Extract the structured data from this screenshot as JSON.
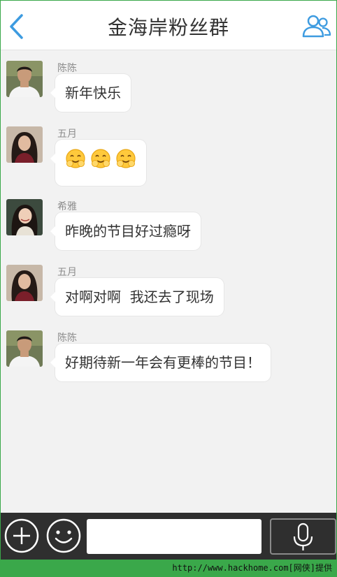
{
  "header": {
    "title": "金海岸粉丝群",
    "back_icon": "chevron-left-icon",
    "members_icon": "group-members-icon"
  },
  "messages": [
    {
      "sender": "陈陈",
      "avatar": "male-avatar",
      "text": "新年快乐"
    },
    {
      "sender": "五月",
      "avatar": "female-avatar-long-hair",
      "text": "",
      "emojis": [
        "hug-emoji",
        "hug-emoji",
        "hug-emoji"
      ]
    },
    {
      "sender": "希雅",
      "avatar": "female-avatar-smiling",
      "text": "昨晚的节目好过瘾呀"
    },
    {
      "sender": "五月",
      "avatar": "female-avatar-long-hair",
      "text": "对啊对啊  我还去了现场"
    },
    {
      "sender": "陈陈",
      "avatar": "male-avatar",
      "text": "好期待新一年会有更棒的节目！"
    }
  ],
  "toolbar": {
    "add_icon": "plus-circle-icon",
    "emoji_icon": "smiley-icon",
    "input_value": "",
    "voice_icon": "microphone-icon"
  },
  "watermark": "http://www.hackhome.com[网侠]提供",
  "colors": {
    "accent_blue": "#3d9be0",
    "frame_green": "#3aa84a",
    "toolbar_dark": "#2f2f2f",
    "chat_background": "#f2f2f2"
  }
}
